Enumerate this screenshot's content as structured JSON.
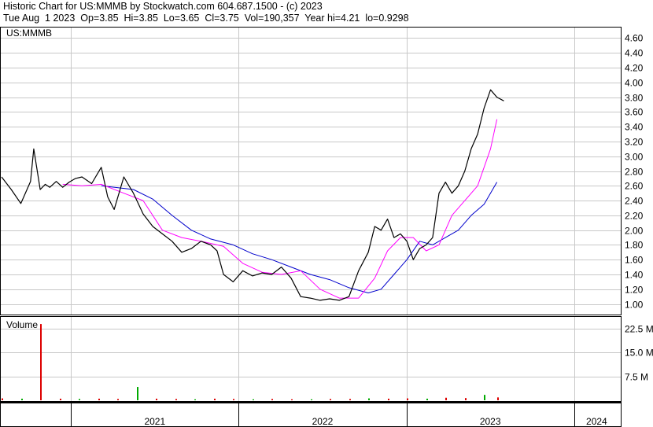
{
  "header": {
    "line1": "Historic Chart for US:MMMB by Stockwatch.com 604.687.1500 - (c) 2023",
    "line2": "Tue Aug  1 2023  Op=3.85  Hi=3.85  Lo=3.65  Cl=3.75  Vol=190,357  Year hi=4.21  lo=0.9298"
  },
  "price_panel": {
    "label": "US:MMMB"
  },
  "volume_panel": {
    "label": "Volume"
  },
  "colors": {
    "price": "#000000",
    "ma_short": "#ff00ff",
    "ma_long": "#0000cc",
    "vol_up": "#00aa00",
    "vol_down": "#dd0000",
    "grid": "#c8c8c8"
  },
  "chart_data": {
    "type": "line",
    "title": "Historic Chart for US:MMMB by Stockwatch.com 604.687.1500 - (c) 2023",
    "ylim": [
      0.9,
      4.7
    ],
    "y_ticks": [
      "4.60",
      "4.40",
      "4.20",
      "4.00",
      "3.80",
      "3.60",
      "3.40",
      "3.20",
      "3.00",
      "2.80",
      "2.60",
      "2.40",
      "2.20",
      "2.00",
      "1.80",
      "1.60",
      "1.40",
      "1.20",
      "1.00"
    ],
    "x_labels": [
      "2021",
      "2022",
      "2023",
      "2024"
    ],
    "volume_ticks": [
      "22.5 M",
      "15.0 M",
      "7.5 M"
    ],
    "volume_ylim_m": [
      0,
      26
    ],
    "grid": true,
    "series": [
      {
        "name": "price",
        "x": [
          "2020-08-03",
          "2020-08-24",
          "2020-09-14",
          "2020-10-05",
          "2020-10-12",
          "2020-10-26",
          "2020-11-06",
          "2020-11-16",
          "2020-11-30",
          "2020-12-14",
          "2020-12-28",
          "2021-01-11",
          "2021-01-25",
          "2021-02-15",
          "2021-03-08",
          "2021-03-22",
          "2021-04-05",
          "2021-04-26",
          "2021-05-17",
          "2021-06-07",
          "2021-06-28",
          "2021-07-19",
          "2021-08-09",
          "2021-08-30",
          "2021-09-20",
          "2021-10-11",
          "2021-11-01",
          "2021-11-15",
          "2021-11-29",
          "2021-12-20",
          "2022-01-10",
          "2022-01-31",
          "2022-02-21",
          "2022-03-14",
          "2022-04-04",
          "2022-04-25",
          "2022-05-16",
          "2022-06-06",
          "2022-06-27",
          "2022-07-18",
          "2022-08-08",
          "2022-08-29",
          "2022-09-19",
          "2022-10-10",
          "2022-10-24",
          "2022-11-07",
          "2022-11-21",
          "2022-12-05",
          "2022-12-19",
          "2023-01-02",
          "2023-01-16",
          "2023-01-30",
          "2023-02-13",
          "2023-02-27",
          "2023-03-13",
          "2023-03-27",
          "2023-04-10",
          "2023-04-24",
          "2023-05-08",
          "2023-05-22",
          "2023-06-05",
          "2023-06-19",
          "2023-07-03",
          "2023-07-17",
          "2023-08-01"
        ],
        "values": [
          2.72,
          2.55,
          2.36,
          2.66,
          3.1,
          2.55,
          2.62,
          2.58,
          2.66,
          2.58,
          2.65,
          2.7,
          2.72,
          2.63,
          2.85,
          2.45,
          2.28,
          2.72,
          2.5,
          2.22,
          2.05,
          1.95,
          1.85,
          1.7,
          1.75,
          1.85,
          1.8,
          1.72,
          1.4,
          1.3,
          1.45,
          1.38,
          1.42,
          1.4,
          1.5,
          1.35,
          1.1,
          1.08,
          1.05,
          1.07,
          1.05,
          1.1,
          1.45,
          1.7,
          2.05,
          2.0,
          2.15,
          1.9,
          1.95,
          1.85,
          1.6,
          1.75,
          1.8,
          1.9,
          2.5,
          2.65,
          2.5,
          2.6,
          2.8,
          3.1,
          3.3,
          3.65,
          3.9,
          3.8,
          3.75
        ]
      },
      {
        "name": "ma_short",
        "x": [
          "2020-12-14",
          "2021-01-25",
          "2021-03-08",
          "2021-04-26",
          "2021-06-07",
          "2021-07-19",
          "2021-08-30",
          "2021-10-11",
          "2021-11-29",
          "2022-01-10",
          "2022-02-21",
          "2022-04-04",
          "2022-05-16",
          "2022-06-27",
          "2022-08-08",
          "2022-09-19",
          "2022-10-24",
          "2022-11-21",
          "2022-12-19",
          "2023-01-16",
          "2023-02-13",
          "2023-03-13",
          "2023-04-10",
          "2023-05-08",
          "2023-06-05",
          "2023-07-03",
          "2023-07-17"
        ],
        "values": [
          2.62,
          2.6,
          2.62,
          2.5,
          2.4,
          2.0,
          1.9,
          1.85,
          1.78,
          1.55,
          1.43,
          1.4,
          1.45,
          1.2,
          1.08,
          1.08,
          1.35,
          1.72,
          1.9,
          1.9,
          1.72,
          1.8,
          2.2,
          2.4,
          2.6,
          3.1,
          3.5
        ]
      },
      {
        "name": "ma_long",
        "x": [
          "2021-03-08",
          "2021-05-17",
          "2021-06-28",
          "2021-08-09",
          "2021-09-20",
          "2021-11-01",
          "2021-12-20",
          "2022-01-31",
          "2022-03-14",
          "2022-04-25",
          "2022-06-06",
          "2022-07-18",
          "2022-08-29",
          "2022-10-10",
          "2022-11-07",
          "2022-12-05",
          "2023-01-02",
          "2023-01-30",
          "2023-02-27",
          "2023-03-27",
          "2023-04-24",
          "2023-05-22",
          "2023-06-19",
          "2023-07-17"
        ],
        "values": [
          2.6,
          2.55,
          2.42,
          2.2,
          2.0,
          1.88,
          1.8,
          1.68,
          1.6,
          1.5,
          1.4,
          1.33,
          1.22,
          1.15,
          1.2,
          1.4,
          1.6,
          1.85,
          1.8,
          1.9,
          2.0,
          2.2,
          2.35,
          2.65
        ]
      },
      {
        "name": "volume_m",
        "x": [
          "2020-08-03",
          "2020-09-14",
          "2020-10-26",
          "2020-12-07",
          "2021-01-18",
          "2021-03-01",
          "2021-04-12",
          "2021-05-24",
          "2021-07-05",
          "2021-08-16",
          "2021-09-27",
          "2021-11-08",
          "2021-12-20",
          "2022-01-31",
          "2022-03-14",
          "2022-04-25",
          "2022-06-06",
          "2022-07-18",
          "2022-08-29",
          "2022-10-10",
          "2022-11-21",
          "2023-01-02",
          "2023-02-13",
          "2023-03-27",
          "2023-05-08",
          "2023-06-19",
          "2023-07-17"
        ],
        "values": [
          0.6,
          0.5,
          24.0,
          0.5,
          0.4,
          0.5,
          0.4,
          4.2,
          0.5,
          0.4,
          0.3,
          0.5,
          0.4,
          0.3,
          0.4,
          0.3,
          0.3,
          0.4,
          0.4,
          0.6,
          0.5,
          0.6,
          0.5,
          0.8,
          0.7,
          1.7,
          0.9
        ]
      }
    ]
  }
}
